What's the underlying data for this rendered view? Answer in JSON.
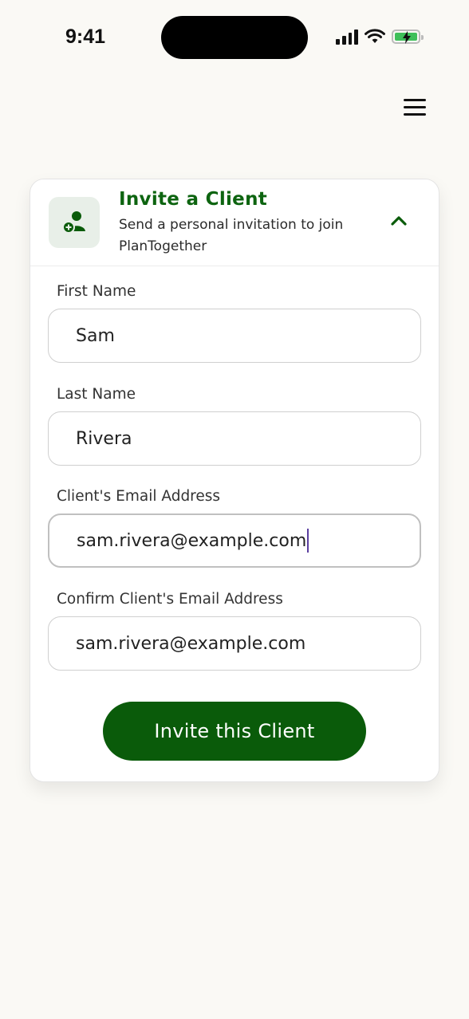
{
  "status_bar": {
    "time": "9:41"
  },
  "card": {
    "title": "Invite a Client",
    "subtitle": "Send a personal invitation to join PlanTogether"
  },
  "form": {
    "first_name": {
      "label": "First Name",
      "value": "Sam"
    },
    "last_name": {
      "label": "Last Name",
      "value": "Rivera"
    },
    "email": {
      "label": "Client's Email Address",
      "value": "sam.rivera@example.com"
    },
    "confirm_email": {
      "label": "Confirm Client's Email Address",
      "value": "sam.rivera@example.com"
    },
    "submit_label": "Invite this Client"
  },
  "colors": {
    "brand_green": "#0a5b0a",
    "title_green": "#0d6410",
    "background": "#faf9f5",
    "caret": "#5b3fa0"
  },
  "icons": [
    "signal-icon",
    "wifi-icon",
    "battery-charging-icon",
    "menu-icon",
    "add-user-icon",
    "chevron-up-icon"
  ]
}
